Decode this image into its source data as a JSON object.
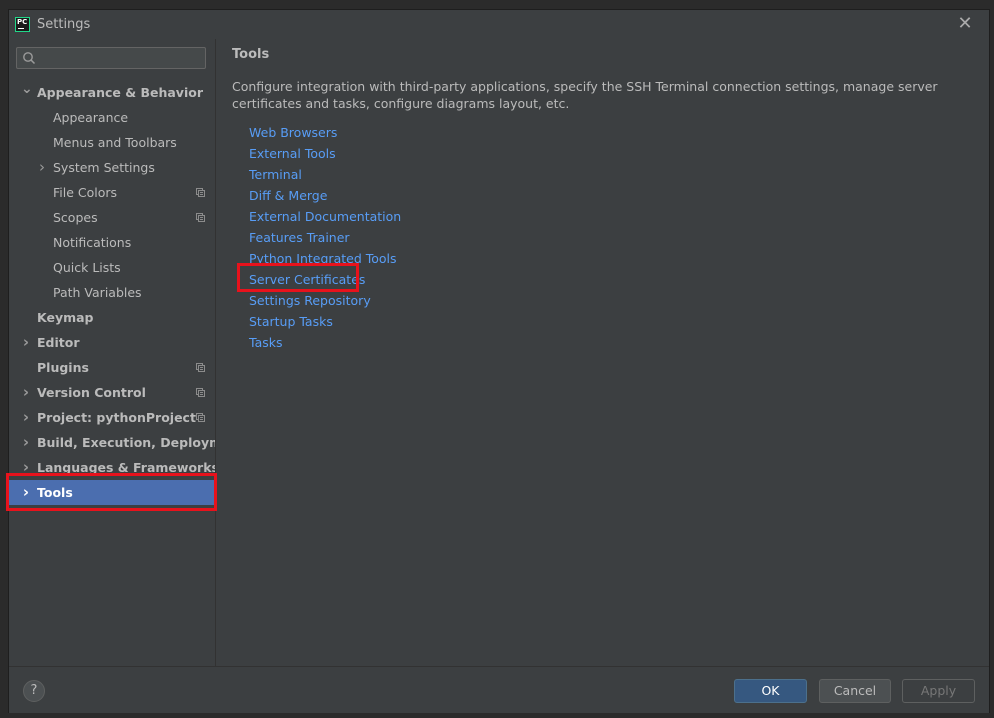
{
  "window": {
    "title": "Settings"
  },
  "search": {
    "placeholder": ""
  },
  "sidebar": {
    "items": [
      {
        "label": "Appearance & Behavior",
        "level": 0,
        "bold": true,
        "expandable": true,
        "expanded": true
      },
      {
        "label": "Appearance",
        "level": 1
      },
      {
        "label": "Menus and Toolbars",
        "level": 1
      },
      {
        "label": "System Settings",
        "level": 1,
        "expandable": true
      },
      {
        "label": "File Colors",
        "level": 1,
        "project_icon": true
      },
      {
        "label": "Scopes",
        "level": 1,
        "project_icon": true
      },
      {
        "label": "Notifications",
        "level": 1
      },
      {
        "label": "Quick Lists",
        "level": 1
      },
      {
        "label": "Path Variables",
        "level": 1
      },
      {
        "label": "Keymap",
        "level": 0,
        "bold": true
      },
      {
        "label": "Editor",
        "level": 0,
        "bold": true,
        "expandable": true
      },
      {
        "label": "Plugins",
        "level": 0,
        "bold": true,
        "project_icon": true
      },
      {
        "label": "Version Control",
        "level": 0,
        "bold": true,
        "expandable": true,
        "project_icon": true
      },
      {
        "label": "Project: pythonProject",
        "level": 0,
        "bold": true,
        "expandable": true,
        "project_icon": true
      },
      {
        "label": "Build, Execution, Deployment",
        "level": 0,
        "bold": true,
        "expandable": true
      },
      {
        "label": "Languages & Frameworks",
        "level": 0,
        "bold": true,
        "expandable": true
      },
      {
        "label": "Tools",
        "level": 0,
        "bold": true,
        "expandable": true,
        "selected": true
      }
    ]
  },
  "content": {
    "title": "Tools",
    "description": "Configure integration with third-party applications, specify the SSH Terminal connection settings, manage server certificates and tasks, configure diagrams layout, etc.",
    "links": [
      "Web Browsers",
      "External Tools",
      "Terminal",
      "Diff & Merge",
      "External Documentation",
      "Features Trainer",
      "Python Integrated Tools",
      "Server Certificates",
      "Settings Repository",
      "Startup Tasks",
      "Tasks"
    ]
  },
  "footer": {
    "help": "?",
    "ok": "OK",
    "cancel": "Cancel",
    "apply": "Apply"
  },
  "colors": {
    "selection": "#4b6eaf",
    "link": "#589df6",
    "highlight": "#e8121c"
  }
}
